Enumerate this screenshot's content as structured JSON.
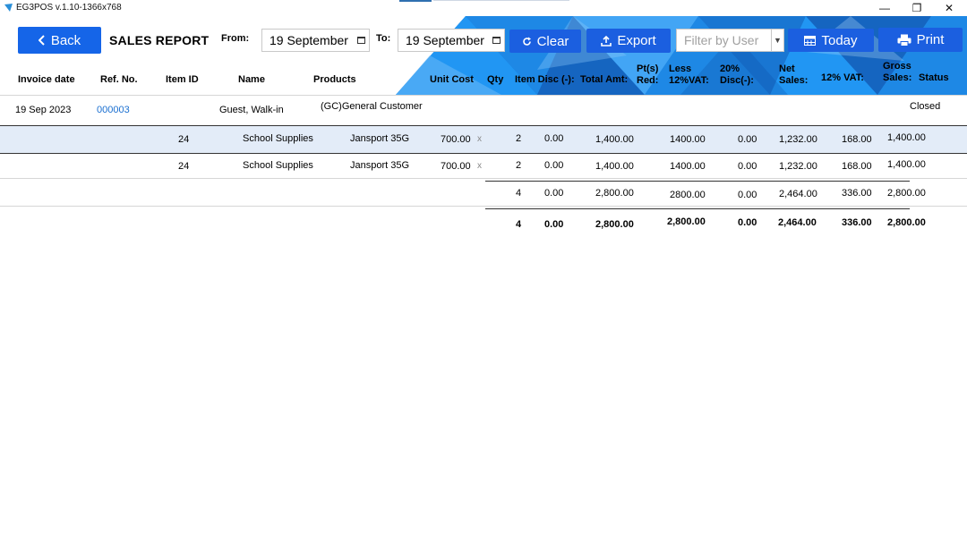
{
  "window": {
    "title": "EG3POS v.1.10-1366x768",
    "minimize": "—",
    "maximize": "❐",
    "close": "✕"
  },
  "toolbar": {
    "back_label": "Back",
    "report_title": "SALES REPORT",
    "from_label": "From:",
    "from_value": "19 September",
    "to_label": "To:",
    "to_value": "19 September",
    "clear_label": "Clear",
    "export_label": "Export",
    "filter_placeholder": "Filter by User",
    "today_label": "Today",
    "print_label": "Print"
  },
  "columns": {
    "invoice_date": "Invoice date",
    "ref_no": "Ref. No.",
    "item_id": "Item ID",
    "name": "Name",
    "products": "Products",
    "unit_cost": "Unit Cost",
    "qty": "Qty",
    "item_disc": "Item Disc (-):",
    "total_amt": "Total Amt:",
    "pts_red_1": "Pt(s)",
    "pts_red_2": "Red:",
    "less_vat_1": "Less",
    "less_vat_2": "12%VAT:",
    "disc20_1": "20%",
    "disc20_2": "Disc(-):",
    "net_sales_1": "Net",
    "net_sales_2": "Sales:",
    "vat12": "12% VAT:",
    "gross_1": "Gross",
    "gross_2": "Sales:",
    "status": "Status"
  },
  "invoice": {
    "date": "19 Sep 2023",
    "ref_no": "000003",
    "customer_name": "Guest, Walk-in",
    "customer": "(GC)General Customer",
    "status": "Closed"
  },
  "items": [
    {
      "item_id": "24",
      "name": "School Supplies",
      "product": "Jansport 35G",
      "unit_cost": "700.00",
      "x": "x",
      "qty": "2",
      "item_disc": "0.00",
      "total_amt": "1,400.00",
      "pts_red": "1400.00",
      "less_vat": "0.00",
      "net_sales": "1,232.00",
      "vat": "168.00",
      "gross": "1,400.00"
    },
    {
      "item_id": "24",
      "name": "School Supplies",
      "product": "Jansport 35G",
      "unit_cost": "700.00",
      "x": "x",
      "qty": "2",
      "item_disc": "0.00",
      "total_amt": "1,400.00",
      "pts_red": "1400.00",
      "less_vat": "0.00",
      "net_sales": "1,232.00",
      "vat": "168.00",
      "gross": "1,400.00"
    }
  ],
  "subtotal": {
    "qty": "4",
    "item_disc": "0.00",
    "total_amt": "2,800.00",
    "pts_red": "2800.00",
    "less_vat": "0.00",
    "net_sales": "2,464.00",
    "vat": "336.00",
    "gross": "2,800.00"
  },
  "grand_total": {
    "qty": "4",
    "item_disc": "0.00",
    "total_amt": "2,800.00",
    "pts_red": "2,800.00",
    "less_vat": "0.00",
    "net_sales": "2,464.00",
    "vat": "336.00",
    "gross": "2,800.00"
  },
  "colors": {
    "accent": "#1565e8",
    "link": "#1a6fd0",
    "row_highlight": "#e3ecf8"
  },
  "icons": [
    "app-icon",
    "chevron-left-icon",
    "refresh-icon",
    "upload-icon",
    "calendar-icon",
    "printer-icon",
    "chevron-down-icon"
  ]
}
